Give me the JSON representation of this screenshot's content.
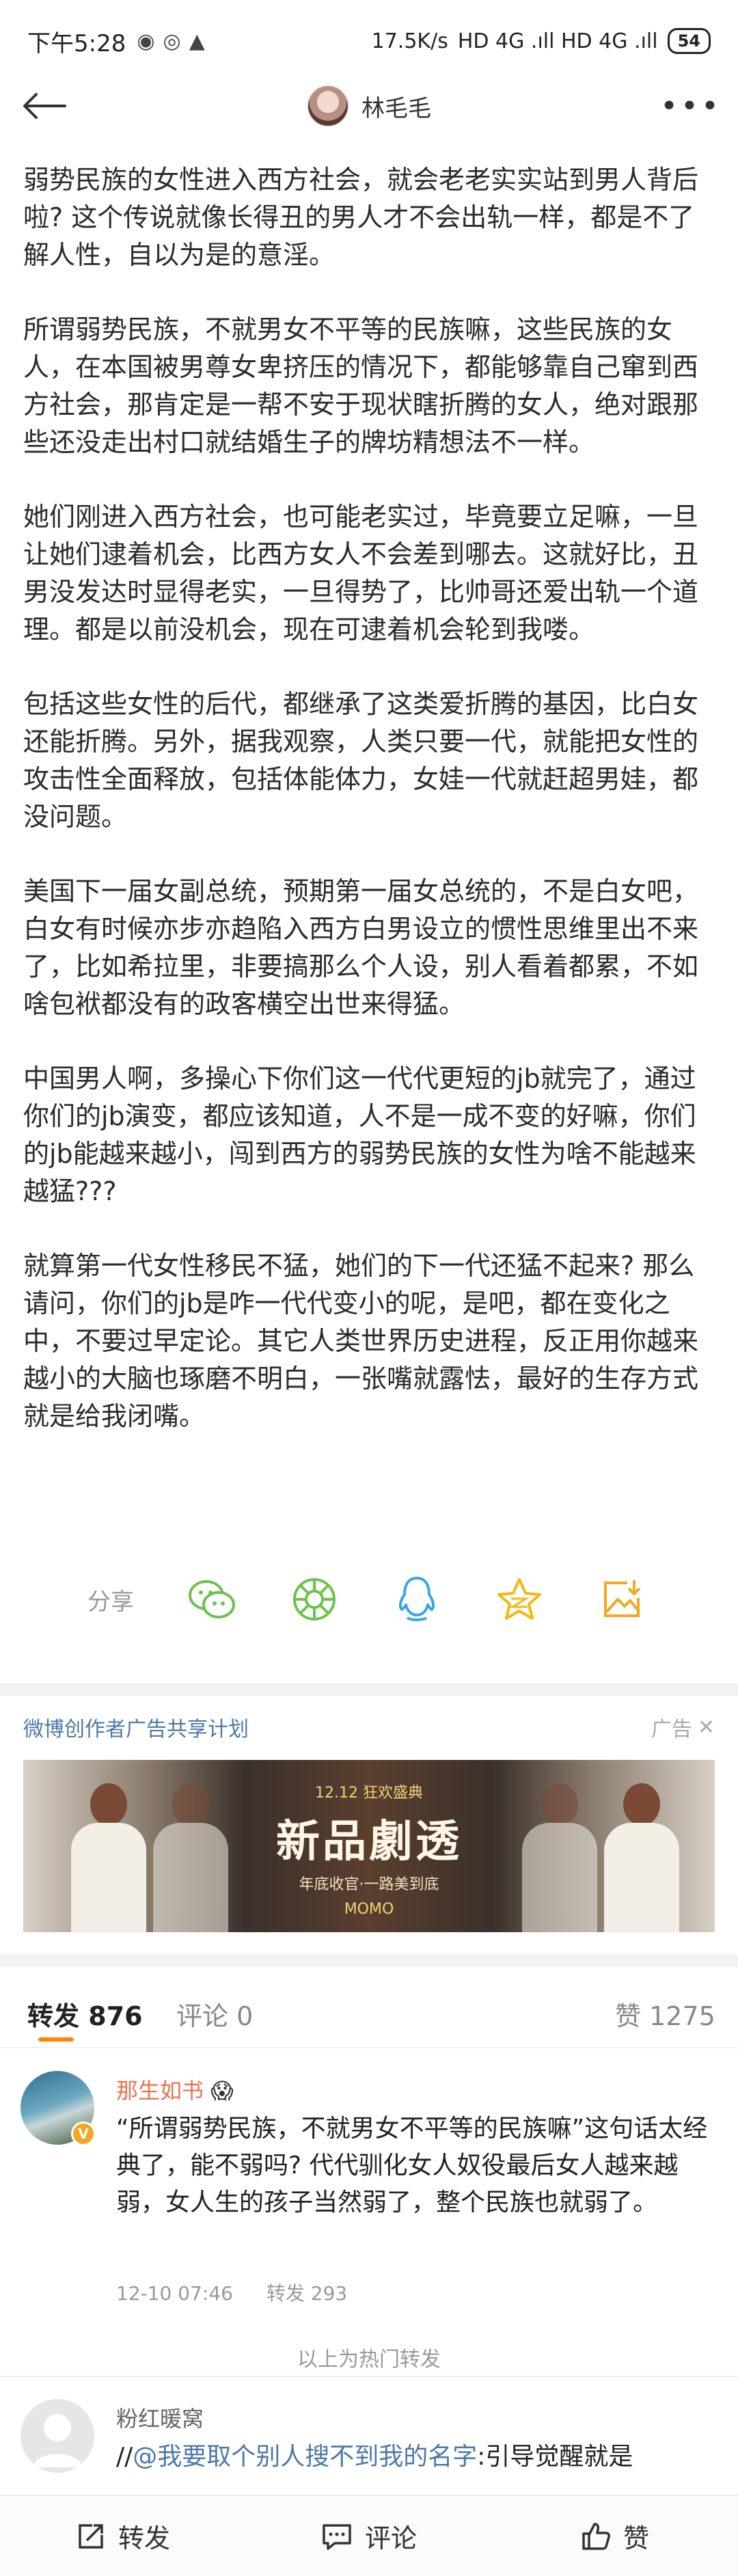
{
  "status_bar": {
    "time": "下午5:28",
    "network_speed": "17.5K/s",
    "indicators": "HD 4G .ıll HD 4G .ıll",
    "battery": "54"
  },
  "nav": {
    "username": "林毛毛"
  },
  "article": {
    "paragraphs": [
      "弱势民族的女性进入西方社会，就会老老实实站到男人背后啦? 这个传说就像长得丑的男人才不会出轨一样，都是不了解人性，自以为是的意淫。",
      "所谓弱势民族，不就男女不平等的民族嘛，这些民族的女人，在本国被男尊女卑挤压的情况下，都能够靠自己窜到西方社会，那肯定是一帮不安于现状瞎折腾的女人，绝对跟那些还没走出村口就结婚生子的牌坊精想法不一样。",
      "她们刚进入西方社会，也可能老实过，毕竟要立足嘛，一旦让她们逮着机会，比西方女人不会差到哪去。这就好比，丑男没发达时显得老实，一旦得势了，比帅哥还爱出轨一个道理。都是以前没机会，现在可逮着机会轮到我喽。",
      "包括这些女性的后代，都继承了这类爱折腾的基因，比白女还能折腾。另外，据我观察，人类只要一代，就能把女性的攻击性全面释放，包括体能体力，女娃一代就赶超男娃，都没问题。",
      "美国下一届女副总统，预期第一届女总统的，不是白女吧，白女有时候亦步亦趋陷入西方白男设立的惯性思维里出不来了，比如希拉里，非要搞那么个人设，别人看着都累，不如啥包袱都没有的政客横空出世来得猛。",
      "中国男人啊，多操心下你们这一代代更短的jb就完了，通过你们的jb演变，都应该知道，人不是一成不变的好嘛，你们的jb能越来越小，闯到西方的弱势民族的女性为啥不能越来越猛???",
      "就算第一代女性移民不猛，她们的下一代还猛不起来? 那么请问，你们的jb是咋一代代变小的呢，是吧，都在变化之中，不要过早定论。其它人类世界历史进程，反正用你越来越小的大脑也琢磨不明白，一张嘴就露怯，最好的生存方式就是给我闭嘴。"
    ]
  },
  "share": {
    "label": "分享",
    "icons": [
      "wechat-icon",
      "moments-icon",
      "qq-icon",
      "qzone-icon",
      "save-image-icon"
    ]
  },
  "ad": {
    "program": "微博创作者广告共享计划",
    "tag": "广告",
    "date": "12.12 狂欢盛典",
    "title": "新品劇透",
    "subtitle": "年底收官·一路美到底",
    "brand": "MOMO"
  },
  "tabs": {
    "repost_label": "转发",
    "repost_count": "876",
    "comment_label": "评论",
    "comment_count": "0",
    "like_label": "赞",
    "like_count": "1275"
  },
  "reposts": [
    {
      "name": "那生如书",
      "emoji": "😱",
      "text": "“所谓弱势民族，不就男女不平等的民族嘛”这句话太经典了，能不弱吗? 代代驯化女人奴役最后女人越来越弱，女人生的孩子当然弱了，整个民族也就弱了。",
      "time": "12-10 07:46",
      "repost_meta": "转发 293"
    },
    {
      "name": "粉红暖窝",
      "prefix": "//",
      "mention": "@我要取个别人搜不到我的名字",
      "text": ":引导觉醒就是"
    }
  ],
  "hot_divider": "以上为热门转发",
  "bottom_bar": {
    "repost": "转发",
    "comment": "评论",
    "like": "赞"
  },
  "colors": {
    "accent": "#ff8200",
    "link": "#4e78a8",
    "muted": "#999999"
  }
}
